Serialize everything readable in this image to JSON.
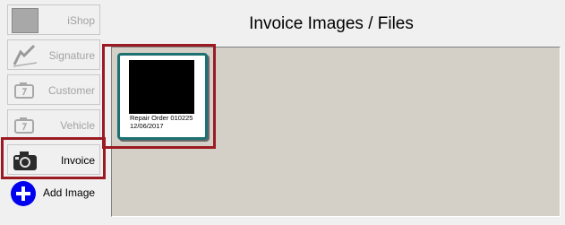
{
  "sidebar": {
    "items": [
      {
        "label": "iShop",
        "icon": "ishop-icon"
      },
      {
        "label": "Signature",
        "icon": "signature-icon"
      },
      {
        "label": "Customer",
        "icon": "customer-icon"
      },
      {
        "label": "Vehicle",
        "icon": "vehicle-icon"
      },
      {
        "label": "Invoice",
        "icon": "camera-icon",
        "active": true
      }
    ],
    "add_image_label": "Add Image"
  },
  "main": {
    "title": "Invoice Images / Files",
    "files": [
      {
        "caption_line1": "Repair Order 010225",
        "caption_line2": "12/06/2017"
      }
    ]
  },
  "colors": {
    "highlight": "#9b1b23",
    "panel": "#d4d0c8",
    "thumb_border": "#1d7172",
    "add_icon": "#0000ee"
  }
}
